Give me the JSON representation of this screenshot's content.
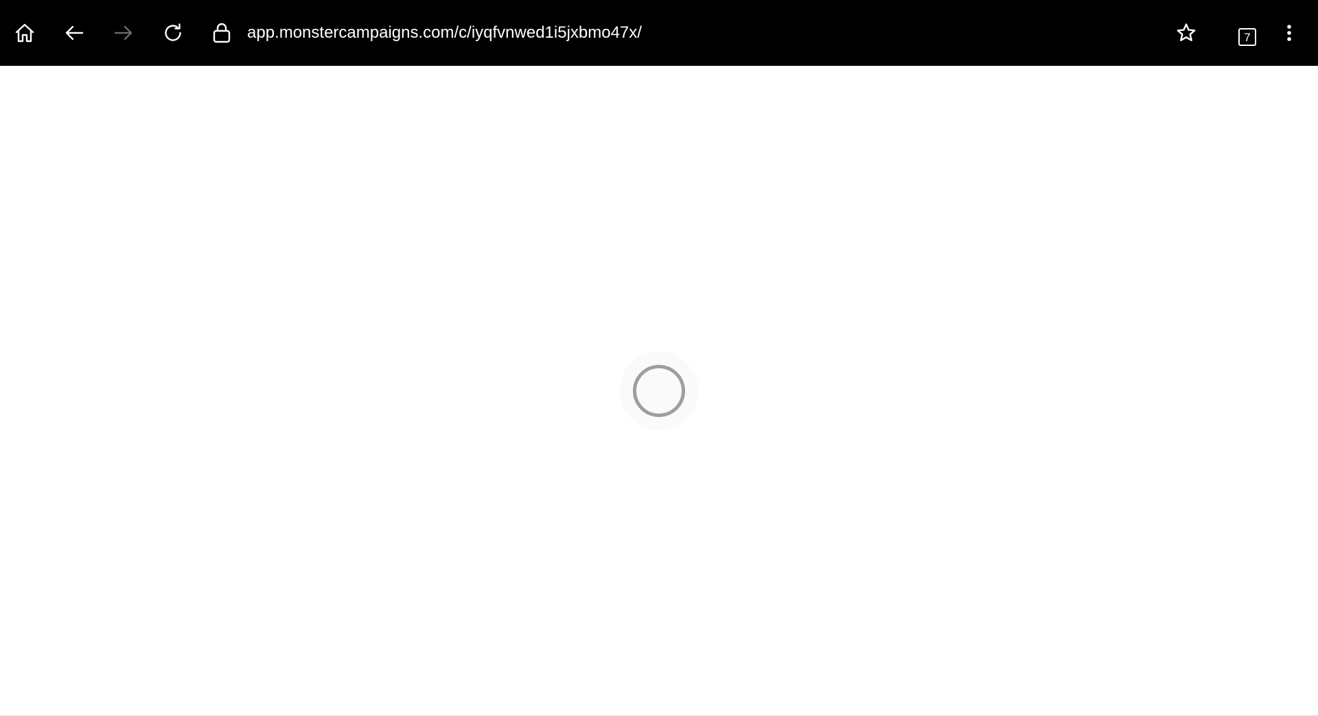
{
  "browser": {
    "url": "app.monstercampaigns.com/c/iyqfvnwed1i5jxbmo47x/",
    "tab_count": "7",
    "icons": {
      "home": "home-icon",
      "back": "arrow-left-icon",
      "forward": "arrow-right-icon",
      "reload": "reload-icon",
      "lock": "lock-icon",
      "bookmark": "star-icon",
      "tabs": "tabs-icon",
      "menu": "kebab-menu-icon"
    },
    "colors": {
      "toolbar_bg": "#000000",
      "toolbar_fg": "#ffffff",
      "forward_disabled": "#6b6b6b",
      "spinner": "#9e9e9e"
    }
  },
  "page": {
    "state": "loading"
  }
}
